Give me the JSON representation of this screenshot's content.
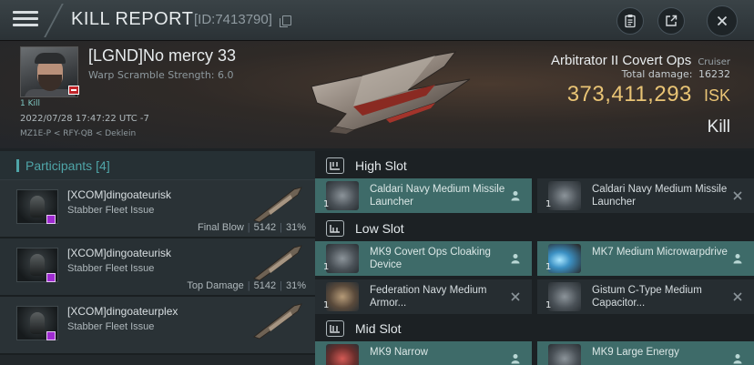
{
  "header": {
    "title": "KILL REPORT",
    "id": "[ID:7413790]"
  },
  "victim": {
    "name": "[LGND]No mercy 33",
    "warp_scramble": "Warp Scramble Strength: 6.0",
    "kills_label": "1 Kill",
    "time": "2022/07/28 17:47:22 UTC -7",
    "location": "MZ1E-P < RFY-QB < Deklein",
    "ship_name": "Arbitrator II Covert Ops",
    "ship_class": "Cruiser",
    "damage_label": "Total damage:",
    "damage_value": "16232",
    "isk_value": "373,411,293",
    "isk_unit": "ISK",
    "kill_type": "Kill"
  },
  "participants": {
    "label": "Participants",
    "count": "[4]",
    "rows": [
      {
        "name": "[XCOM]dingoateurisk",
        "ship": "Stabber Fleet Issue",
        "tag": "Final Blow",
        "damage": "5142",
        "percent": "31%"
      },
      {
        "name": "[XCOM]dingoateurisk",
        "ship": "Stabber Fleet Issue",
        "tag": "Top Damage",
        "damage": "5142",
        "percent": "31%"
      },
      {
        "name": "[XCOM]dingoateurplex",
        "ship": "Stabber Fleet Issue",
        "tag": "",
        "damage": "",
        "percent": ""
      }
    ]
  },
  "fitting": {
    "high_slot": {
      "title": "High Slot",
      "modules": [
        {
          "name": "Caldari Navy Medium Missile Launcher",
          "qty": "1",
          "status": "dropped"
        },
        {
          "name": "Caldari Navy Medium Missile Launcher",
          "qty": "1",
          "status": "destroyed"
        }
      ]
    },
    "low_slot": {
      "title": "Low Slot",
      "modules": [
        {
          "name": "MK9 Covert Ops Cloaking Device",
          "qty": "1",
          "status": "dropped"
        },
        {
          "name": "MK7 Medium Microwarpdrive",
          "qty": "1",
          "status": "dropped"
        },
        {
          "name": "Federation Navy Medium Armor...",
          "qty": "1",
          "status": "destroyed"
        },
        {
          "name": "Gistum C-Type Medium Capacitor...",
          "qty": "1",
          "status": "destroyed"
        }
      ]
    },
    "mid_slot": {
      "title": "Mid Slot",
      "modules": [
        {
          "name": "MK9 Narrow",
          "qty": "",
          "status": "dropped"
        },
        {
          "name": "MK9 Large Energy",
          "qty": "",
          "status": "dropped"
        }
      ]
    }
  },
  "colors": {
    "accent_teal": "#4fa5a8",
    "isk_gold": "#e9c475",
    "dropped_bg": "#3e6b69",
    "destroyed_bg": "#262d31"
  }
}
